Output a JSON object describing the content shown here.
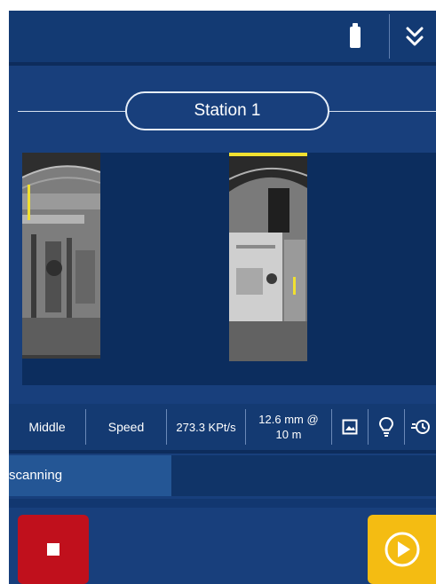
{
  "station": {
    "label": "Station 1"
  },
  "stats": {
    "density": "Middle",
    "mode": "Speed",
    "rate": "273.3 KPt/s",
    "resolution_line1": "12.6 mm @",
    "resolution_line2": "10 m"
  },
  "progress": {
    "label": "scanning",
    "fraction": 0.38
  },
  "icons": {
    "battery": "battery-full-icon",
    "collapse": "double-chevron-down-icon",
    "image": "image-icon",
    "light": "lightbulb-icon",
    "timer": "timer-icon",
    "stop": "stop-icon",
    "play": "play-icon"
  },
  "colors": {
    "background": "#183f7c",
    "stop_button": "#c0101c",
    "play_button": "#f4bc12"
  }
}
